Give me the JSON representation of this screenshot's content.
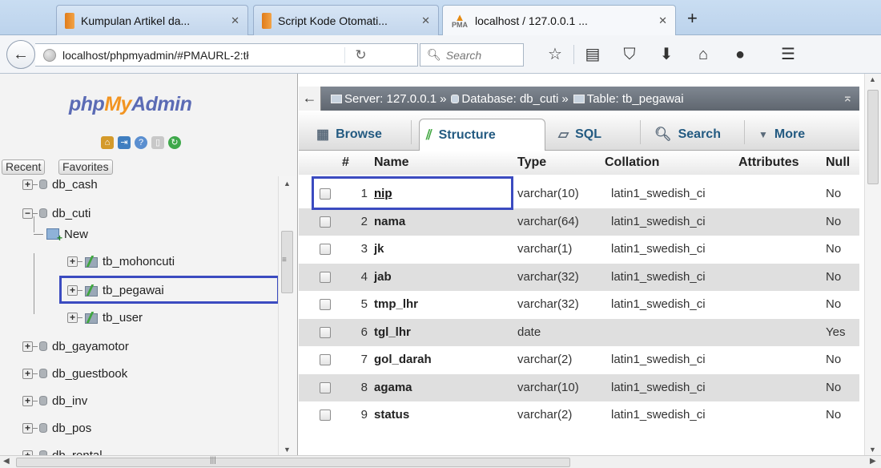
{
  "browser": {
    "tabs": [
      {
        "title": "Kumpulan Artikel da...",
        "close": "✕",
        "active": false
      },
      {
        "title": "Script Kode Otomati...",
        "close": "✕",
        "active": false
      },
      {
        "title": "localhost / 127.0.0.1 ...",
        "close": "✕",
        "active": true
      }
    ],
    "pma_favicon_text": "PMA",
    "new_tab": "+",
    "url": "localhost/phpmyadmin/#PMAURL-2:tł",
    "search_placeholder": "Search",
    "icons": [
      "star-icon",
      "reading-list-icon",
      "pocket-icon",
      "download-icon",
      "home-icon",
      "chat-icon",
      "menu-icon"
    ]
  },
  "sidebar": {
    "logo": {
      "php": "php",
      "my": "My",
      "admin": "Admin"
    },
    "recent_label": "Recent",
    "favorites_label": "Favorites",
    "tree": [
      {
        "label": "db_cash",
        "type": "db",
        "expander": "+"
      },
      {
        "label": "db_cuti",
        "type": "db",
        "expander": "−"
      },
      {
        "label": "New",
        "type": "new"
      },
      {
        "label": "tb_mohoncuti",
        "type": "table",
        "expander": "+"
      },
      {
        "label": "tb_pegawai",
        "type": "table",
        "expander": "+",
        "selected": true
      },
      {
        "label": "tb_user",
        "type": "table",
        "expander": "+"
      },
      {
        "label": "db_gayamotor",
        "type": "db",
        "expander": "+"
      },
      {
        "label": "db_guestbook",
        "type": "db",
        "expander": "+"
      },
      {
        "label": "db_inv",
        "type": "db",
        "expander": "+"
      },
      {
        "label": "db_pos",
        "type": "db",
        "expander": "+"
      },
      {
        "label": "db_rental",
        "type": "db",
        "expander": "+"
      }
    ]
  },
  "breadcrumb": {
    "server": "Server: 127.0.0.1",
    "database": "Database: db_cuti",
    "table": "Table: tb_pegawai",
    "sep": "»"
  },
  "tabs": {
    "browse": "Browse",
    "structure": "Structure",
    "sql": "SQL",
    "search": "Search",
    "more": "More"
  },
  "table": {
    "headers": {
      "num": "#",
      "name": "Name",
      "type": "Type",
      "collation": "Collation",
      "attributes": "Attributes",
      "null": "Null"
    },
    "rows": [
      {
        "num": "1",
        "name": "nip",
        "type": "varchar(10)",
        "collation": "latin1_swedish_ci",
        "null": "No"
      },
      {
        "num": "2",
        "name": "nama",
        "type": "varchar(64)",
        "collation": "latin1_swedish_ci",
        "null": "No"
      },
      {
        "num": "3",
        "name": "jk",
        "type": "varchar(1)",
        "collation": "latin1_swedish_ci",
        "null": "No"
      },
      {
        "num": "4",
        "name": "jab",
        "type": "varchar(32)",
        "collation": "latin1_swedish_ci",
        "null": "No"
      },
      {
        "num": "5",
        "name": "tmp_lhr",
        "type": "varchar(32)",
        "collation": "latin1_swedish_ci",
        "null": "No"
      },
      {
        "num": "6",
        "name": "tgl_lhr",
        "type": "date",
        "collation": "",
        "null": "Yes"
      },
      {
        "num": "7",
        "name": "gol_darah",
        "type": "varchar(2)",
        "collation": "latin1_swedish_ci",
        "null": "No"
      },
      {
        "num": "8",
        "name": "agama",
        "type": "varchar(10)",
        "collation": "latin1_swedish_ci",
        "null": "No"
      },
      {
        "num": "9",
        "name": "status",
        "type": "varchar(2)",
        "collation": "latin1_swedish_ci",
        "null": "No"
      }
    ]
  },
  "colors": {
    "highlight": "#3b4bc0",
    "link": "#235a81",
    "server_bar": "#6b737c",
    "row_alt": "#dfdfdf"
  }
}
